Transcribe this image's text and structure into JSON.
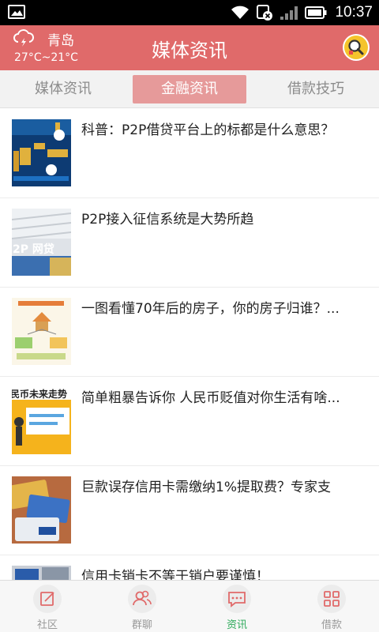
{
  "status_bar": {
    "time": "10:37",
    "icons": [
      "image-icon",
      "wifi-icon",
      "data-off-icon",
      "signal-icon",
      "battery-icon"
    ]
  },
  "header": {
    "city": "青岛",
    "temperature": "27°C~21°C",
    "title": "媒体资讯",
    "weather_icon": "cloud-lightning-icon",
    "search_icon": "magnifier-icon"
  },
  "tabs": [
    {
      "label": "媒体资讯",
      "active": false
    },
    {
      "label": "金融资讯",
      "active": true
    },
    {
      "label": "借款技巧",
      "active": false
    }
  ],
  "articles": [
    {
      "title": "科普：P2P借贷平台上的标都是什么意思？"
    },
    {
      "title": "P2P接入征信系统是大势所趋"
    },
    {
      "title": "一图看懂70年后的房子，你的房子归谁？..."
    },
    {
      "title": "简单粗暴告诉你 人民币贬值对你生活有啥..."
    },
    {
      "title": "巨款误存信用卡需缴纳1%提取费？专家支"
    },
    {
      "title": "信用卡销卡不等于销户要谨慎！"
    }
  ],
  "thumbnail_text": {
    "p2p": "2P 网贷",
    "rmb": "民币未来走势"
  },
  "bottom_nav": [
    {
      "label": "社区",
      "icon": "edit-icon",
      "active": false
    },
    {
      "label": "群聊",
      "icon": "group-icon",
      "active": false
    },
    {
      "label": "资讯",
      "icon": "chat-icon",
      "active": true
    },
    {
      "label": "借款",
      "icon": "grid-icon",
      "active": false
    }
  ],
  "colors": {
    "header": "#e06a6a",
    "active_tab": "#e69a9a",
    "active_nav": "#2daa5a"
  }
}
